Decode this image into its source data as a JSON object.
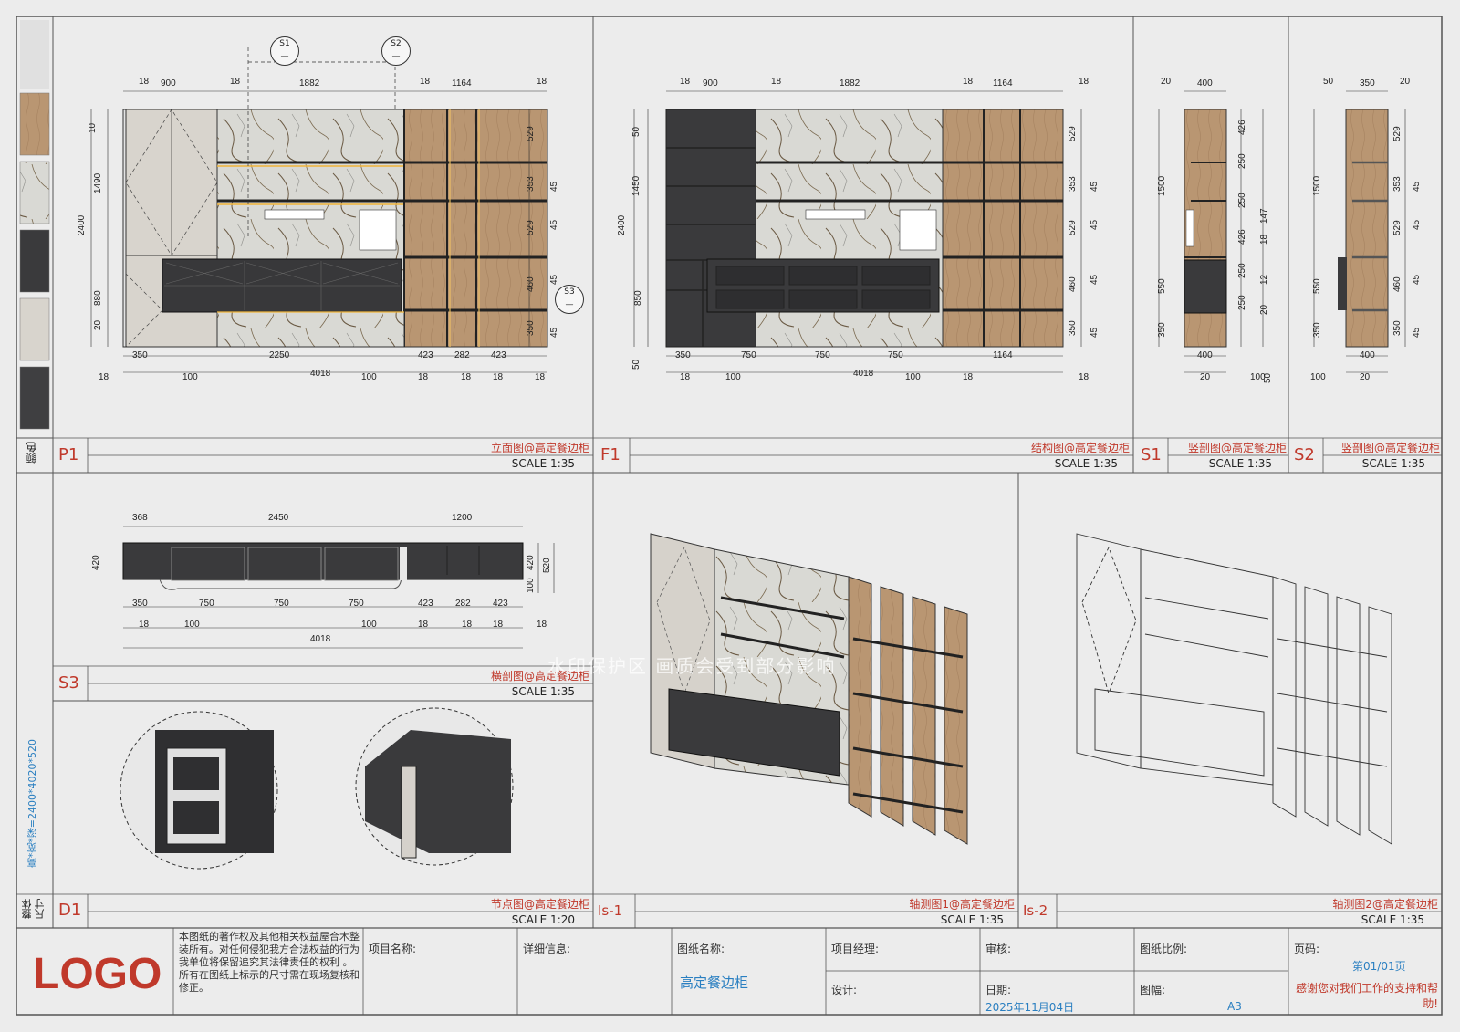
{
  "colors": {
    "frame": "#555555",
    "accent_red": "#c0392b",
    "accent_blue": "#2a7fc1",
    "wood": "#b99672",
    "dark_panel": "#3a3a3c",
    "marble": "#d7d7d2",
    "light_panel": "#d8d4cd",
    "led": "#f0b43a"
  },
  "sidebar": {
    "swatches": [
      "wood-swatch",
      "marble-swatch",
      "dark-swatch",
      "light-swatch",
      "charcoal-swatch"
    ],
    "color_label": "颜色",
    "dimension_text": "高*宽*深=2400*4020*520",
    "overall_label_1": "整体",
    "overall_label_2": "尺寸"
  },
  "panels": {
    "p1": {
      "code": "P1",
      "title": "立面图@高定餐边柜",
      "scale": "SCALE 1:35"
    },
    "f1": {
      "code": "F1",
      "title": "结构图@高定餐边柜",
      "scale": "SCALE 1:35"
    },
    "s1": {
      "code": "S1",
      "title": "竖剖图@高定餐边柜",
      "scale": "SCALE 1:35"
    },
    "s2": {
      "code": "S2",
      "title": "竖剖图@高定餐边柜",
      "scale": "SCALE 1:35"
    },
    "s3": {
      "code": "S3",
      "title": "横剖图@高定餐边柜",
      "scale": "SCALE 1:35"
    },
    "d1": {
      "code": "D1",
      "title": "节点图@高定餐边柜",
      "scale": "SCALE 1:20"
    },
    "is1": {
      "code": "Is-1",
      "title": "轴测图1@高定餐边柜",
      "scale": "SCALE 1:35"
    },
    "is2": {
      "code": "Is-2",
      "title": "轴测图2@高定餐边柜",
      "scale": "SCALE 1:35"
    }
  },
  "dims": {
    "p1_top": [
      "18",
      "900",
      "18",
      "1882",
      "18",
      "1164",
      "18"
    ],
    "p1_bottom1": [
      "350",
      "2250",
      "423",
      "282",
      "423"
    ],
    "p1_bottom2": [
      "18",
      "100",
      "4018",
      "100",
      "18",
      "18",
      "18",
      "18"
    ],
    "p1_left": [
      "10",
      "1490",
      "2400",
      "880",
      "20"
    ],
    "p1_right": [
      "529",
      "353",
      "45",
      "529",
      "45",
      "460",
      "45",
      "350",
      "45"
    ],
    "f1_top": [
      "18",
      "900",
      "18",
      "1882",
      "18",
      "1164",
      "18"
    ],
    "f1_bottom1": [
      "350",
      "750",
      "750",
      "750",
      "1164"
    ],
    "f1_bottom2": [
      "18",
      "100",
      "4018",
      "100",
      "18",
      "18"
    ],
    "f1_left": [
      "50",
      "1450",
      "2400",
      "850",
      "50"
    ],
    "f1_right": [
      "529",
      "353",
      "45",
      "529",
      "45",
      "460",
      "45",
      "350",
      "45"
    ],
    "s1_top": [
      "20",
      "400"
    ],
    "s1_inner": [
      "426",
      "250",
      "250",
      "147",
      "426",
      "18",
      "250",
      "12",
      "250",
      "20"
    ],
    "s1_left": [
      "1500",
      "550",
      "350"
    ],
    "s1_bottom": [
      "400",
      "20",
      "100",
      "50"
    ],
    "s2_top": [
      "50",
      "350",
      "20"
    ],
    "s2_right": [
      "529",
      "353",
      "45",
      "529",
      "45",
      "460",
      "45",
      "350",
      "45"
    ],
    "s2_left": [
      "1500",
      "550",
      "350"
    ],
    "s2_bottom": [
      "400",
      "100",
      "20"
    ],
    "s3_top": [
      "368",
      "2450",
      "1200"
    ],
    "s3_bottom1": [
      "350",
      "750",
      "750",
      "750",
      "423",
      "282",
      "423"
    ],
    "s3_bottom2": [
      "18",
      "100",
      "100",
      "18",
      "18",
      "18",
      "18"
    ],
    "s3_total": "4018",
    "s3_right": [
      "420",
      "520",
      "100"
    ],
    "s3_left": "420"
  },
  "markers": {
    "s1": "S1",
    "s2": "S2",
    "s3": "S3"
  },
  "watermark": "水印保护区  画质会受到部分影响",
  "title_block": {
    "logo": "LOGO",
    "copyright": "本图纸的著作权及其他相关权益屋合木整装所有。对任何侵犯我方合法权益的行为我单位将保留追究其法律责任的权利 。\n所有在图纸上标示的尺寸需在现场复核和修正。",
    "project_name_label": "项目名称:",
    "detail_label": "详细信息:",
    "drawing_name_label": "图纸名称:",
    "drawing_name_value": "高定餐边柜",
    "pm_label": "项目经理:",
    "design_label": "设计:",
    "review_label": "审核:",
    "date_label": "日期:",
    "date_value": "2025年11月04日",
    "scale_label": "图纸比例:",
    "format_label": "图幅:",
    "format_value": "A3",
    "page_label": "页码:",
    "page_value": "第01/01页",
    "thanks": "感谢您对我们工作的支持和帮助!"
  }
}
